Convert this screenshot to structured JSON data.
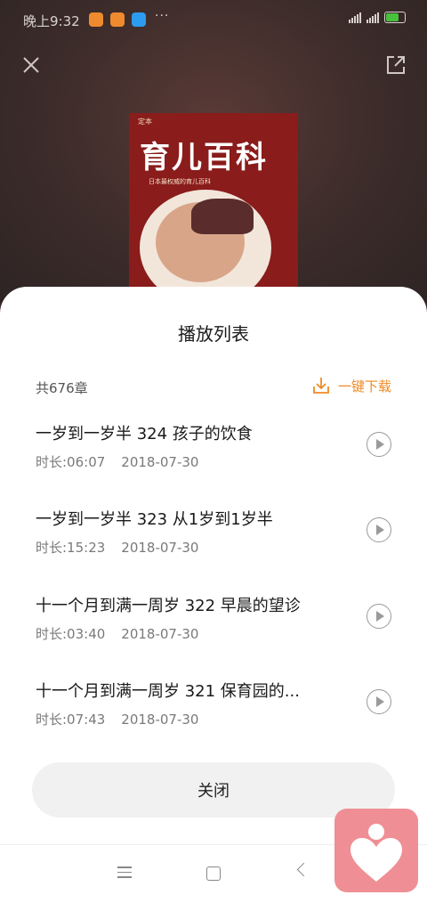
{
  "status_bar": {
    "time": "晚上9:32",
    "more": "···"
  },
  "header": {
    "close_icon": "close-icon",
    "share_icon": "share-icon"
  },
  "cover": {
    "topline": "定本",
    "title": "育儿百科",
    "subtitle": "日本最权威的育儿百科"
  },
  "playlist": {
    "title": "播放列表",
    "count": "共676章",
    "download_label": "一键下载",
    "accent_color": "#f08a24",
    "items": [
      {
        "title": "一岁到一岁半 324 孩子的饮食",
        "duration": "时长:06:07",
        "date": "2018-07-30"
      },
      {
        "title": "一岁到一岁半 323 从1岁到1岁半",
        "duration": "时长:15:23",
        "date": "2018-07-30"
      },
      {
        "title": "十一个月到满一周岁 322 早晨的望诊",
        "duration": "时长:03:40",
        "date": "2018-07-30"
      },
      {
        "title": "十一个月到满一周岁 321 保育园的...",
        "duration": "时长:07:43",
        "date": "2018-07-30"
      }
    ],
    "close_label": "关闭"
  },
  "nav_bar": {
    "menu_icon": "menu-icon",
    "home_icon": "home-icon",
    "back_icon": "back-icon"
  },
  "floating_app": {
    "icon": "heart-person-icon",
    "color": "#ef8f95"
  }
}
